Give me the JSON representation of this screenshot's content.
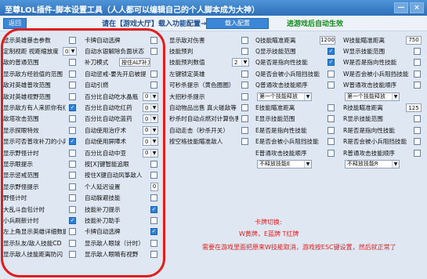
{
  "window": {
    "title": "至尊LOL插件-脚本设置工具（人人都可以编辑自己的个人脚本成为大神）",
    "buttons": [
      "—",
      "×"
    ]
  },
  "toolbar": {
    "back_label": "返回",
    "hint_load": "请在【游戏大厅】载入功能配置→",
    "load_label": "载入配置",
    "hint_auto": "进游戏后自动生效"
  },
  "col1": [
    {
      "label": "显示英雄暴击参数",
      "checked": false
    },
    {
      "label": "定制视距  视距缩放度",
      "select": "0"
    },
    {
      "label": "敌的普通范围",
      "checked": false
    },
    {
      "label": "显示敌方经验值的范围",
      "checked": false
    },
    {
      "label": "敌对英雄普攻范围",
      "checked": false
    },
    {
      "label": "敌对英雄视野范围",
      "checked": false
    },
    {
      "label": "显示敌方有人来抓你有红字",
      "checked": true
    },
    {
      "label": "敌塔攻击范围",
      "checked": false
    },
    {
      "label": "显示探眼特效",
      "checked": false
    },
    {
      "label": "显示可否普攻补刀的小兵",
      "checked": true
    },
    {
      "label": "显示野怪计时",
      "checked": false
    },
    {
      "label": "显示眼提示",
      "checked": false
    },
    {
      "label": "显示惩戒范围",
      "checked": false
    },
    {
      "label": "显示野怪提示",
      "checked": false
    },
    {
      "label": "野怪计时",
      "checked": false
    },
    {
      "label": "大乱斗血包计时",
      "checked": false
    },
    {
      "label": "小兵刷新计时",
      "checked": true
    },
    {
      "label": "左上角显示英雄详细数据",
      "checked": false
    },
    {
      "label": "显示队友/敌人技能CD",
      "checked": false
    },
    {
      "label": "显示敌人技能距离防闪",
      "checked": false
    }
  ],
  "col2": [
    {
      "label": "卡牌自动选牌",
      "checked": false
    },
    {
      "label": "自动水银解除负面状态",
      "checked": false
    },
    {
      "label": "补刀模式",
      "select": "按住ALT补刀"
    },
    {
      "label": "自动惩戒-要先开启被提示",
      "checked": false
    },
    {
      "label": "自动引燃",
      "checked": false
    },
    {
      "label": "百分比自动吃水晶瓶",
      "select": "0"
    },
    {
      "label": "百分比自动吃红药",
      "select": "0"
    },
    {
      "label": "百分比自动吃蓝药",
      "select": "0"
    },
    {
      "label": "自动使用治疗术",
      "select": "0"
    },
    {
      "label": "自动使用屏障术",
      "select": "0"
    },
    {
      "label": "百分比自动中亚",
      "select": "0"
    },
    {
      "label": "按[X]键智能追眼",
      "checked": false
    },
    {
      "label": "按住X键自动风筝敌人",
      "checked": false
    },
    {
      "label": "个人延迟设置",
      "number": "0"
    },
    {
      "label": "自动躲避技能",
      "checked": false
    },
    {
      "label": "技能补刀提示",
      "checked": true
    },
    {
      "label": "技能补刀助手",
      "checked": false
    },
    {
      "label": "卡牌自动选牌",
      "checked": true
    },
    {
      "label": "显示敌人眼球（计时）",
      "checked": false
    },
    {
      "label": "显示敌人眼睛有视野",
      "checked": false
    }
  ],
  "col3": [
    {
      "label": "显示敌对伤害",
      "checked": false
    },
    {
      "label": "技能预判",
      "checked": false
    },
    {
      "label": "技能预判数值",
      "select": "2"
    },
    {
      "label": "左键锁定英雄",
      "checked": false
    },
    {
      "label": "可秒杀提示（黄色圈圈）",
      "checked": false
    },
    {
      "label": "大招秒杀提示",
      "checked": false
    },
    {
      "label": "自动物品出售  真火碰敌等",
      "checked": false
    },
    {
      "label": "秒杀时自动点燃对计算伤害",
      "checked": false
    },
    {
      "label": "自动走击（秒杀开关）",
      "checked": false
    },
    {
      "label": "按空格技能瞄准敌人",
      "checked": false
    }
  ],
  "col4": [
    {
      "label": "Q技能瞄准距离",
      "number": "1200"
    },
    {
      "label": "Q显示技能范围",
      "checked": true
    },
    {
      "label": "Q是否是指向性技能",
      "checked": true
    },
    {
      "label": "Q是否会被小兵阻挡技能",
      "checked": false
    },
    {
      "label": "Q普通攻击技能顺序",
      "checked": false
    },
    {
      "label": "第一个技能释放",
      "select": "第一个技能释放"
    },
    {
      "label": "E技能瞄准距离",
      "checked": false
    },
    {
      "label": "E显示技能范围",
      "checked": false
    },
    {
      "label": "E是否是指向性技能",
      "checked": false
    },
    {
      "label": "E是否会被小兵阻挡技能",
      "checked": false
    },
    {
      "label": "E普通攻击技能顺序",
      "checked": false
    },
    {
      "label": "不释放技能",
      "select": "不释放技能E"
    }
  ],
  "col5": [
    {
      "label": "W技能瞄准距离",
      "number": "750"
    },
    {
      "label": "W显示技能范围",
      "checked": false
    },
    {
      "label": "W是否是指向性技能",
      "checked": false
    },
    {
      "label": "W是否会被小兵阻挡技能",
      "checked": false
    },
    {
      "label": "W普通攻击技能顺序",
      "checked": false
    },
    {
      "label": "第一个技能释放",
      "select": "第一个技能释放"
    },
    {
      "label": "R技能瞄准距离",
      "number": "125"
    },
    {
      "label": "R显示技能范围",
      "checked": false
    },
    {
      "label": "R是否是指向性技能",
      "checked": false
    },
    {
      "label": "R是否会被小兵阻挡技能",
      "checked": false
    },
    {
      "label": "R普通攻击技能顺序",
      "checked": false
    },
    {
      "label": "不释放技能",
      "select": "不释放技能R"
    }
  ],
  "kara": {
    "title": "卡牌切换:",
    "keys": "W黄牌，E蓝牌  T红牌",
    "note": "需要在游戏里面把原来W技能取消，游戏按ESC键设置，然后就正常了"
  },
  "colors": {
    "accent": "#2f7fd5",
    "frame": "#e01e1e",
    "toolbar_text": "#1c4f90",
    "hint_green": "#128a1b"
  }
}
